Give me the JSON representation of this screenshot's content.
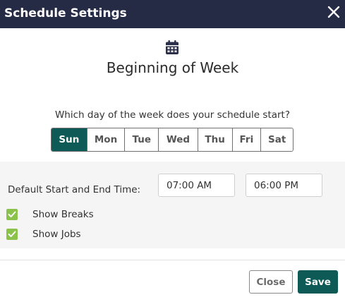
{
  "dialog": {
    "title": "Schedule Settings",
    "close_icon": "close-icon",
    "calendar_icon": "calendar-icon",
    "heading": "Beginning of Week",
    "question": "Which day of the week does your schedule start?"
  },
  "days": [
    {
      "label": "Sun",
      "selected": true
    },
    {
      "label": "Mon",
      "selected": false
    },
    {
      "label": "Tue",
      "selected": false
    },
    {
      "label": "Wed",
      "selected": false
    },
    {
      "label": "Thu",
      "selected": false
    },
    {
      "label": "Fri",
      "selected": false
    },
    {
      "label": "Sat",
      "selected": false
    }
  ],
  "times": {
    "label": "Default Start and End Time:",
    "start": "07:00 AM",
    "end": "06:00 PM"
  },
  "options": {
    "show_breaks": {
      "label": "Show Breaks",
      "checked": true
    },
    "show_jobs": {
      "label": "Show Jobs",
      "checked": true
    }
  },
  "buttons": {
    "close": "Close",
    "save": "Save"
  },
  "colors": {
    "header_bg": "#252a45",
    "accent": "#0e5a57",
    "checkbox": "#8bc34a"
  }
}
